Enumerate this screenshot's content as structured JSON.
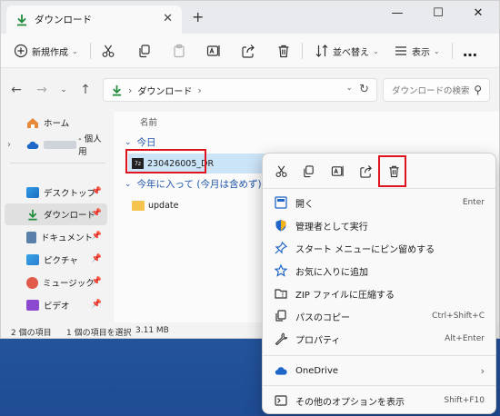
{
  "window": {
    "tab_title": "ダウンロード",
    "new_tab": "+",
    "controls": {
      "minimize": "—",
      "maximize": "☐",
      "close": "✕"
    }
  },
  "command_bar": {
    "new_label": "新規作成",
    "sort_label": "並べ替え",
    "view_label": "表示",
    "more": "…"
  },
  "address_bar": {
    "crumb": "ダウンロード",
    "search_placeholder": "ダウンロードの検索"
  },
  "sidebar": {
    "home": "ホーム",
    "onedrive": "- 個人用",
    "items": [
      {
        "label": "デスクトップ",
        "pinned": true
      },
      {
        "label": "ダウンロード",
        "pinned": true,
        "selected": true
      },
      {
        "label": "ドキュメント",
        "pinned": true
      },
      {
        "label": "ピクチャ",
        "pinned": true
      },
      {
        "label": "ミュージック",
        "pinned": true
      },
      {
        "label": "ビデオ",
        "pinned": true
      }
    ]
  },
  "main": {
    "column_name": "名前",
    "group_today": "今日",
    "file_today": "230426005_DR",
    "group_year": "今年に入って (今月は含めず)",
    "folder_year": "update"
  },
  "status": {
    "count": "2 個の項目",
    "selected": "1 個の項目を選択",
    "size": "3.11 MB"
  },
  "context_menu": {
    "items": [
      {
        "label": "開く",
        "shortcut": "Enter"
      },
      {
        "label": "管理者として実行",
        "shortcut": ""
      },
      {
        "label": "スタート メニューにピン留めする",
        "shortcut": ""
      },
      {
        "label": "お気に入りに追加",
        "shortcut": ""
      },
      {
        "label": "ZIP ファイルに圧縮する",
        "shortcut": ""
      },
      {
        "label": "パスのコピー",
        "shortcut": "Ctrl+Shift+C"
      },
      {
        "label": "プロパティ",
        "shortcut": "Alt+Enter"
      }
    ],
    "onedrive": "OneDrive",
    "more_options": "その他のオプションを表示",
    "more_shortcut": "Shift+F10"
  },
  "colors": {
    "highlight": "#e0141e",
    "accent": "#1f66c9",
    "selection": "#cce4f7"
  }
}
